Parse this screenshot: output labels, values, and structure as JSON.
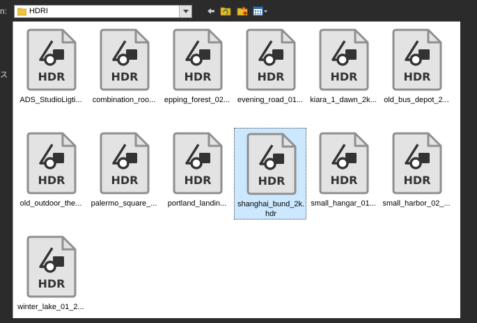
{
  "toolbar": {
    "look_in_label": "n:",
    "path_value": "HDRI",
    "back_icon": "back-arrow-icon",
    "up_folder_icon": "up-folder-icon",
    "new_folder_icon": "new-folder-icon",
    "view_menu_icon": "view-menu-icon"
  },
  "sidebar": {
    "partial_text": "ス"
  },
  "file_icon_label": "HDR",
  "colors": {
    "icon_fill": "#e3e3e3",
    "icon_stroke": "#8f8f8f",
    "icon_glyph": "#333333",
    "selection_bg": "#cce8ff"
  },
  "files": [
    {
      "label": "ADS_StudioLigti..."
    },
    {
      "label": "combination_roo..."
    },
    {
      "label": "epping_forest_02..."
    },
    {
      "label": "evening_road_01..."
    },
    {
      "label": "kiara_1_dawn_2k..."
    },
    {
      "label": "old_bus_depot_2..."
    },
    {
      "label": "old_outdoor_the..."
    },
    {
      "label": "palermo_square_..."
    },
    {
      "label": "portland_landin..."
    },
    {
      "label": "shanghai_bund_2k.\nhdr",
      "selected": true
    },
    {
      "label": "small_hangar_01..."
    },
    {
      "label": "small_harbor_02_..."
    },
    {
      "label": "winter_lake_01_2..."
    }
  ]
}
